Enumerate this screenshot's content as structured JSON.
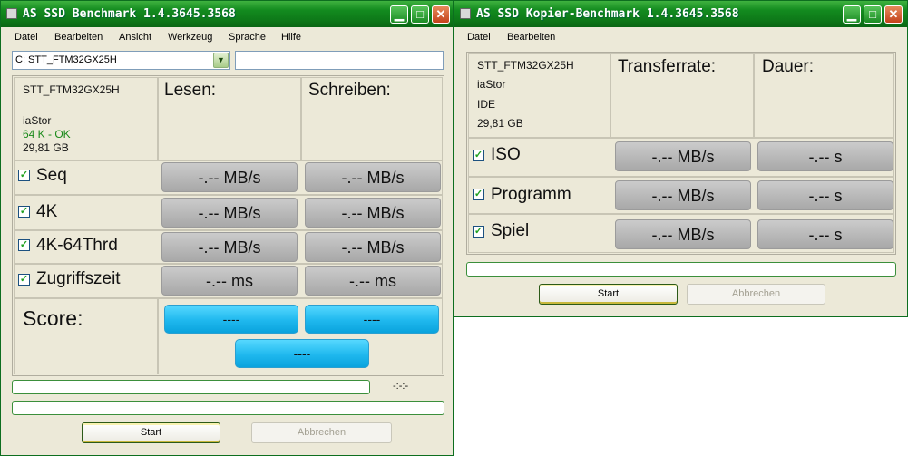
{
  "main": {
    "title": "AS SSD Benchmark 1.4.3645.3568",
    "window_buttons": {
      "minimize": "▁",
      "maximize": "□",
      "close": "✕"
    },
    "menu": [
      "Datei",
      "Bearbeiten",
      "Ansicht",
      "Werkzeug",
      "Sprache",
      "Hilfe"
    ],
    "drive_select": "C: STT_FTM32GX25H",
    "drive_select_arrow": "▼",
    "device": {
      "model": "STT_FTM32GX25H",
      "driver": "iaStor",
      "align": "64 K - OK",
      "size": "29,81 GB"
    },
    "col_read": "Lesen:",
    "col_write": "Schreiben:",
    "rows": [
      {
        "label": "Seq",
        "read": "-.-- MB/s",
        "write": "-.-- MB/s",
        "checked": true
      },
      {
        "label": "4K",
        "read": "-.-- MB/s",
        "write": "-.-- MB/s",
        "checked": true
      },
      {
        "label": "4K-64Thrd",
        "read": "-.-- MB/s",
        "write": "-.-- MB/s",
        "checked": true
      },
      {
        "label": "Zugriffszeit",
        "read": "-.-- ms",
        "write": "-.-- ms",
        "checked": true
      }
    ],
    "check_mark": "✓",
    "score_label": "Score:",
    "score_read": "----",
    "score_write": "----",
    "score_total": "----",
    "time_display": "-:-:-",
    "start_label": "Start",
    "abort_label": "Abbrechen"
  },
  "copy": {
    "title": "AS SSD Kopier-Benchmark 1.4.3645.3568",
    "window_buttons": {
      "minimize": "▁",
      "maximize": "□",
      "close": "✕"
    },
    "menu": [
      "Datei",
      "Bearbeiten"
    ],
    "device": {
      "model": "STT_FTM32GX25H",
      "driver": "iaStor",
      "bus": "IDE",
      "size": "29,81 GB"
    },
    "col_rate": "Transferrate:",
    "col_time": "Dauer:",
    "rows": [
      {
        "label": "ISO",
        "rate": "-.-- MB/s",
        "time": "-.-- s",
        "checked": true
      },
      {
        "label": "Programm",
        "rate": "-.-- MB/s",
        "time": "-.-- s",
        "checked": true
      },
      {
        "label": "Spiel",
        "rate": "-.-- MB/s",
        "time": "-.-- s",
        "checked": true
      }
    ],
    "start_label": "Start",
    "abort_label": "Abbrechen"
  },
  "colors": {
    "titlebar": "#138b1f",
    "score_accent": "#1fb8ee",
    "align_ok": "#1a8a1a"
  }
}
